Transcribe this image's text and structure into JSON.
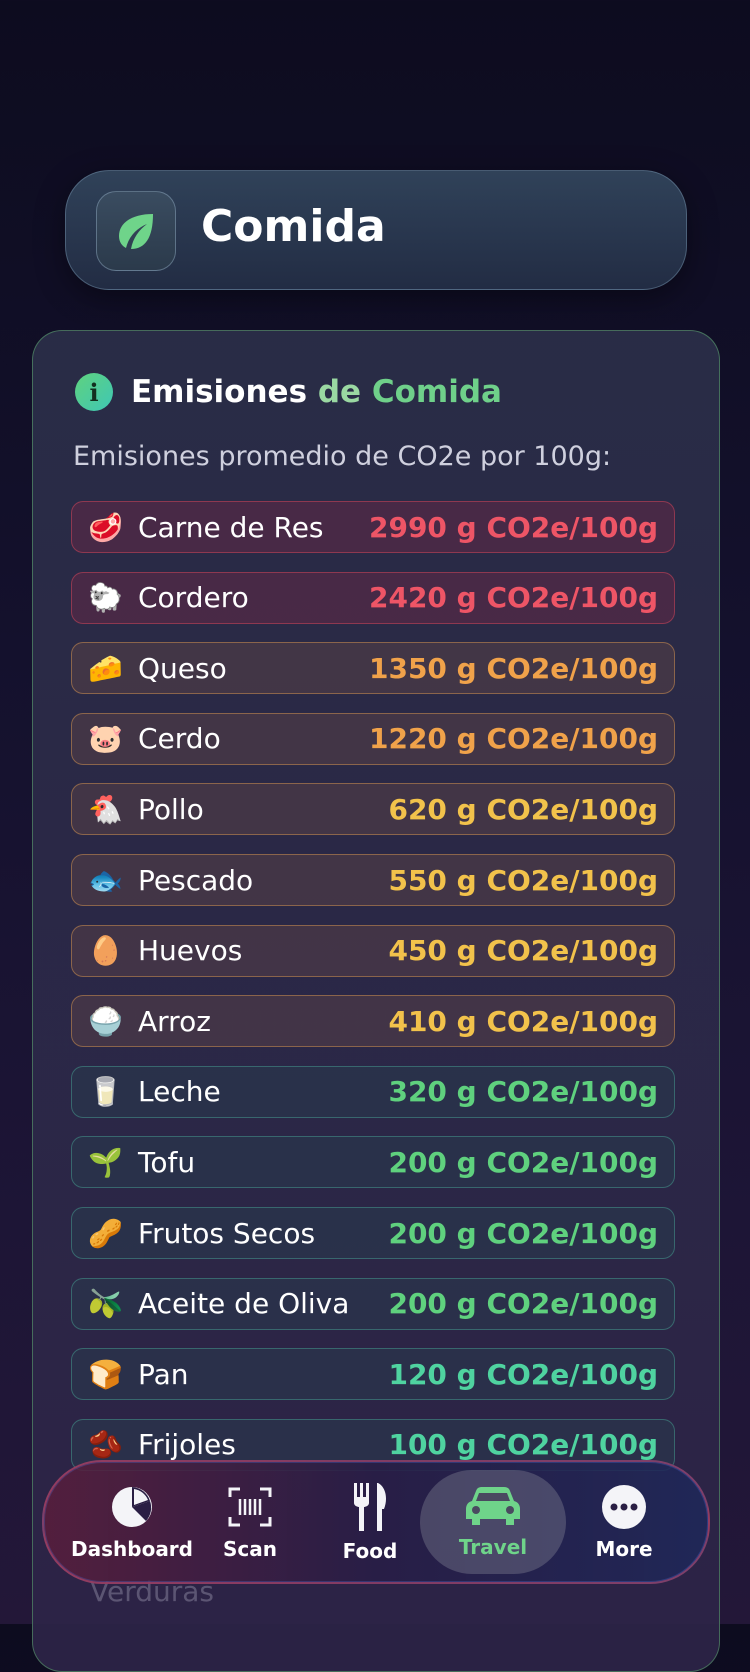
{
  "header": {
    "title": "Comida",
    "icon": "leaf-icon"
  },
  "card": {
    "title_part1": "Emisiones",
    "title_part2": "de",
    "title_part3": "Comida",
    "subtitle": "Emisiones promedio de CO2e por 100g:",
    "items": [
      {
        "emoji": "🥩",
        "name": "Carne de Res",
        "value": "2990 g CO2e/100g",
        "tone": "red",
        "valColor": "red"
      },
      {
        "emoji": "🐑",
        "name": "Cordero",
        "value": "2420 g CO2e/100g",
        "tone": "red",
        "valColor": "red"
      },
      {
        "emoji": "🧀",
        "name": "Queso",
        "value": "1350 g CO2e/100g",
        "tone": "orange",
        "valColor": "orange"
      },
      {
        "emoji": "🐷",
        "name": "Cerdo",
        "value": "1220 g CO2e/100g",
        "tone": "orange",
        "valColor": "orange"
      },
      {
        "emoji": "🐔",
        "name": "Pollo",
        "value": "620 g CO2e/100g",
        "tone": "orange",
        "valColor": "yellow"
      },
      {
        "emoji": "🐟",
        "name": "Pescado",
        "value": "550 g CO2e/100g",
        "tone": "orange",
        "valColor": "yellow"
      },
      {
        "emoji": "🥚",
        "name": "Huevos",
        "value": "450 g CO2e/100g",
        "tone": "orange",
        "valColor": "yellow"
      },
      {
        "emoji": "🍚",
        "name": "Arroz",
        "value": "410 g CO2e/100g",
        "tone": "orange",
        "valColor": "yellow"
      },
      {
        "emoji": "🥛",
        "name": "Leche",
        "value": "320 g CO2e/100g",
        "tone": "green",
        "valColor": "green"
      },
      {
        "emoji": "🌱",
        "name": "Tofu",
        "value": "200 g CO2e/100g",
        "tone": "green",
        "valColor": "green"
      },
      {
        "emoji": "🥜",
        "name": "Frutos Secos",
        "value": "200 g CO2e/100g",
        "tone": "green",
        "valColor": "green"
      },
      {
        "emoji": "🫒",
        "name": "Aceite de Oliva",
        "value": "200 g CO2e/100g",
        "tone": "green",
        "valColor": "green"
      },
      {
        "emoji": "🍞",
        "name": "Pan",
        "value": "120 g CO2e/100g",
        "tone": "green",
        "valColor": "teal"
      },
      {
        "emoji": "🫘",
        "name": "Frijoles",
        "value": "100 g CO2e/100g",
        "tone": "green",
        "valColor": "teal"
      }
    ],
    "hidden_next": "Verduras"
  },
  "nav": {
    "items": [
      {
        "label": "Dashboard",
        "icon": "pie-chart-icon"
      },
      {
        "label": "Scan",
        "icon": "barcode-scan-icon"
      },
      {
        "label": "Food",
        "icon": "fork-knife-icon"
      },
      {
        "label": "Travel",
        "icon": "car-icon",
        "active": true
      },
      {
        "label": "More",
        "icon": "more-dots-icon"
      }
    ]
  },
  "colors": {
    "accent_green": "#6fd48a",
    "red": "#ee5566",
    "orange": "#f0a24a",
    "yellow": "#f2c24b"
  }
}
